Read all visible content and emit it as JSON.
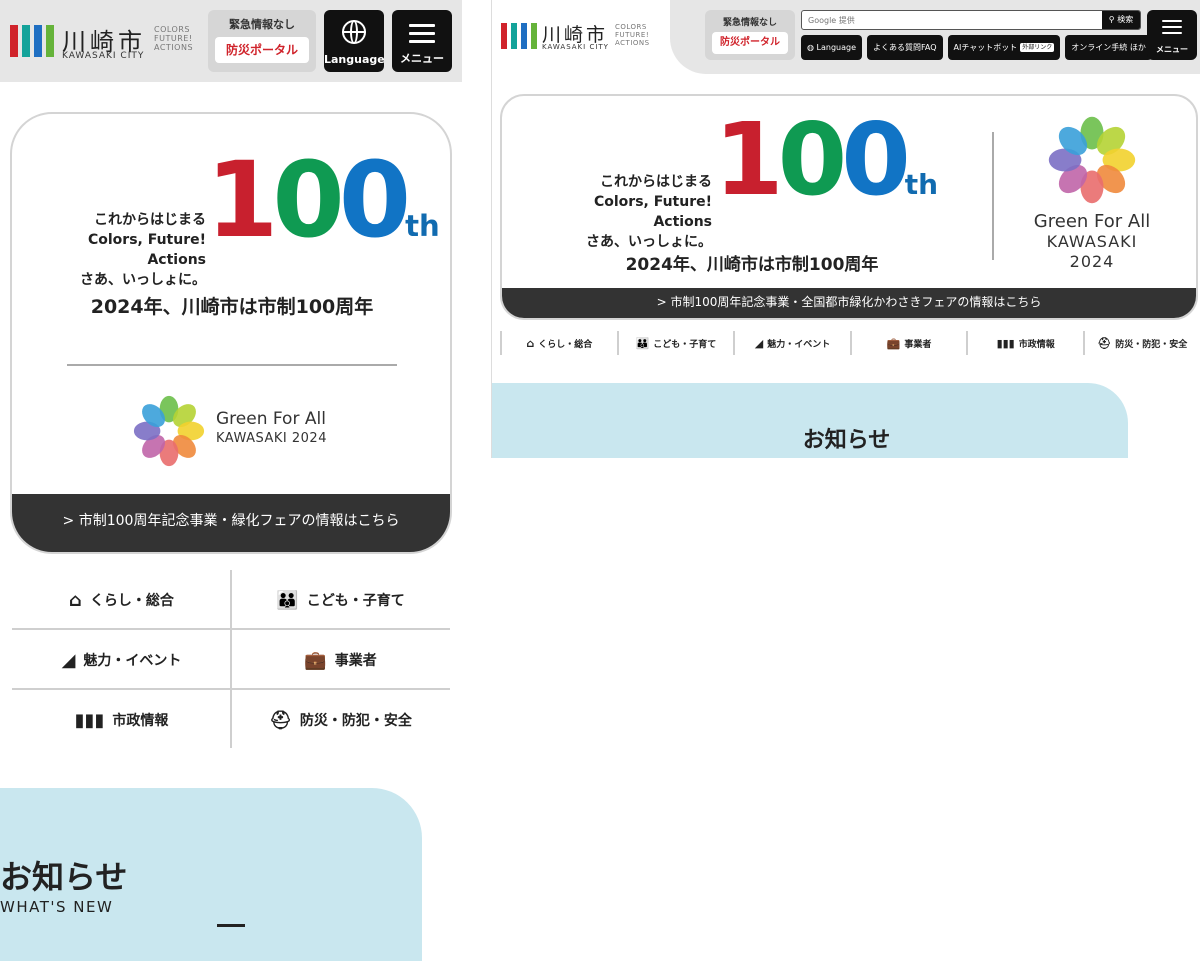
{
  "colors": {
    "red": "#c8202e",
    "green": "#0f9a52",
    "blue": "#1174c5",
    "header_bg": "#e6e6e6",
    "news_bg": "#c9e7ef",
    "dark": "#111111"
  },
  "header": {
    "city_name": "川崎市",
    "city_en": "KAWASAKI CITY",
    "cfa_line1": "COLORS",
    "cfa_line2": "FUTURE!",
    "cfa_line3": "ACTIONS",
    "alert_text": "緊急情報なし",
    "portal_label": "防災ポータル",
    "language_label": "Language",
    "menu_label": "メニュー",
    "search_placeholder": "Google 提供",
    "search_button": "検索",
    "pills": {
      "language": "Language",
      "faq": "よくある質問FAQ",
      "ai_chat": "AIチャットボット",
      "ai_chat_tag": "外部リンク",
      "online": "オンライン手続 ほか"
    }
  },
  "banner": {
    "slogan_line1": "これからはじまる",
    "slogan_line2": "Colors, Future! Actions",
    "slogan_line3": "さあ、いっしょに。",
    "hundred_d1": "1",
    "hundred_d2": "0",
    "hundred_d3": "0",
    "hundred_suffix": "th",
    "headline": "2024年、川崎市は市制100周年",
    "gfa_line1": "Green For All",
    "gfa_sub_mobile": "KAWASAKI 2024",
    "gfa_sub_desktop_1": "KAWASAKI",
    "gfa_sub_desktop_2": "2024",
    "link_mobile": "> 市制100周年記念事業・緑化フェアの情報はこちら",
    "link_desktop": "> 市制100周年記念事業・全国都市緑化かわさきフェアの情報はこちら"
  },
  "nav": {
    "living": "くらし・総合",
    "kids": "こども・子育て",
    "attractions": "魅力・イベント",
    "business": "事業者",
    "city_admin": "市政情報",
    "safety": "防災・防犯・安全"
  },
  "news": {
    "title": "お知らせ",
    "subtitle": "WHAT'S NEW"
  }
}
